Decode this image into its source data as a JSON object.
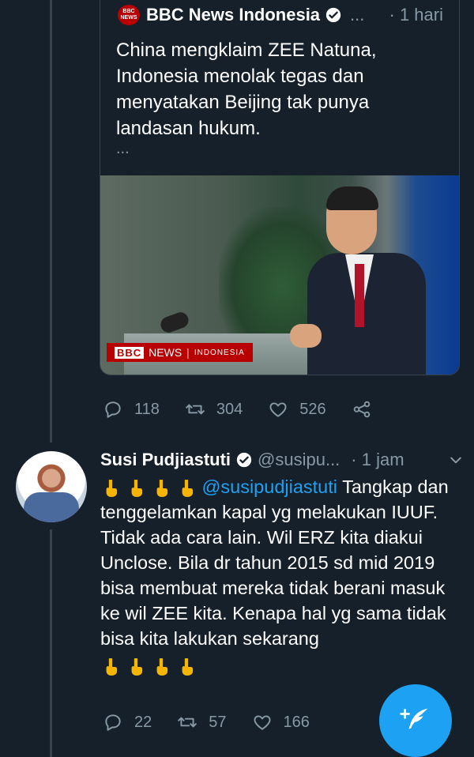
{
  "quoted_tweet": {
    "logo_text_1": "BBC",
    "logo_text_2": "NEWS",
    "author_name": "BBC News Indonesia",
    "name_ellipsis": "...",
    "time": "· 1 hari",
    "text": "China mengklaim ZEE Natuna,\nIndonesia menolak tegas dan\nmenyatakan Beijing tak punya\nlandasan hukum.",
    "more": "...",
    "photo_overlay": {
      "brand": "BBC",
      "news": "NEWS",
      "region": "INDONESIA"
    },
    "actions": {
      "replies": "118",
      "retweets": "304",
      "likes": "526"
    }
  },
  "tweet": {
    "author_name": "Susi Pudjiastuti",
    "handle": "@susipu...",
    "time": "· 1 jam",
    "mention": "@susipudjiastuti",
    "text": " Tangkap dan tenggelamkan kapal yg melakukan IUUF. Tidak ada cara lain. Wil ERZ kita diakui Unclose. Bila dr tahun 2015 sd mid 2019 bisa membuat mereka tidak berani masuk ke wil ZEE kita. Kenapa hal yg sama tidak bisa kita lakukan sekarang",
    "actions": {
      "replies": "22",
      "retweets": "57",
      "likes": "166"
    }
  },
  "colors": {
    "background": "#15202b",
    "accent": "#1da1f2",
    "muted": "#8899a6",
    "border": "#38444d"
  },
  "icons": [
    "verified-badge-icon",
    "reply-icon",
    "retweet-icon",
    "like-icon",
    "share-icon",
    "chevron-down-icon",
    "compose-tweet-icon",
    "backhand-index-pointing-down-emoji"
  ]
}
